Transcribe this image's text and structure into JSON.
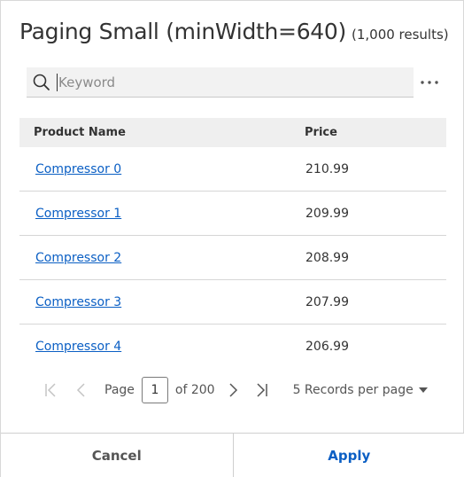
{
  "dialog": {
    "title": "Paging Small (minWidth=640)",
    "result_count": "(1,000 results)"
  },
  "search": {
    "placeholder": "Keyword",
    "value": "",
    "icon": "search-icon"
  },
  "more_menu": {
    "icon": "more-horizontal-icon"
  },
  "table": {
    "columns": [
      "Product Name",
      "Price"
    ],
    "rows": [
      {
        "name": "Compressor 0",
        "price": "210.99"
      },
      {
        "name": "Compressor 1",
        "price": "209.99"
      },
      {
        "name": "Compressor 2",
        "price": "208.99"
      },
      {
        "name": "Compressor 3",
        "price": "207.99"
      },
      {
        "name": "Compressor 4",
        "price": "206.99"
      }
    ]
  },
  "pager": {
    "page_label": "Page",
    "current_page": "1",
    "of_label": "of 200",
    "records_per_page": "5 Records per page",
    "icons": [
      "first-page-icon",
      "previous-page-icon",
      "next-page-icon",
      "last-page-icon",
      "caret-down-icon"
    ]
  },
  "footer": {
    "cancel_label": "Cancel",
    "apply_label": "Apply"
  },
  "colors": {
    "link": "#0b5fc4",
    "header_bg": "#efefef",
    "search_bg": "#f2f2f2"
  }
}
